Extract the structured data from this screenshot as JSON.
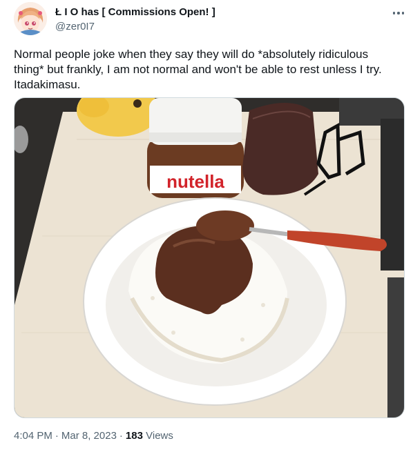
{
  "author": {
    "display_name": "Ł I O has [ Commissions Open! ]",
    "handle": "@zer0I7"
  },
  "tweet": {
    "text": "Normal people joke when they say they will do *absolutely ridiculous thing* but frankly, I am not normal and won't be able to rest unless I try.\nItadakimasu.",
    "media": {
      "jar_brand": "nutella"
    }
  },
  "meta": {
    "time": "4:04 PM",
    "separator": "·",
    "date": "Mar 8, 2023",
    "views_count": "183",
    "views_label": "Views"
  },
  "icons": {
    "more": "more-horizontal-icon"
  },
  "colors": {
    "primary_text": "#0f1419",
    "secondary_text": "#536471",
    "border": "#cfd9de"
  }
}
